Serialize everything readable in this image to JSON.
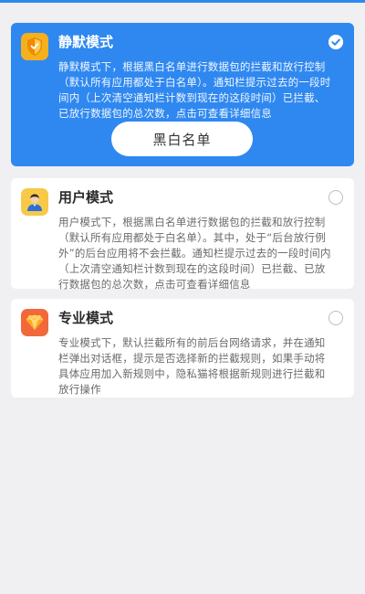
{
  "modes": {
    "silent": {
      "title": "静默模式",
      "icon": "shield-icon",
      "selected": true,
      "description": "静默模式下，根据黑白名单进行数据包的拦截和放行控制（默认所有应用都处于白名单）。通知栏提示过去的一段时间内（上次清空通知栏计数到现在的这段时间）已拦截、已放行数据包的总次数，点击可查看详细信息",
      "button_label": "黑白名单"
    },
    "user": {
      "title": "用户模式",
      "icon": "user-avatar-icon",
      "selected": false,
      "description": "用户模式下，根据黑白名单进行数据包的拦截和放行控制（默认所有应用都处于白名单）。其中，处于“后台放行例外”的后台应用将不会拦截。通知栏提示过去的一段时间内（上次清空通知栏计数到现在的这段时间）已拦截、已放行数据包的总次数，点击可查看详细信息"
    },
    "pro": {
      "title": "专业模式",
      "icon": "diamond-icon",
      "selected": false,
      "description": "专业模式下，默认拦截所有的前后台网络请求，并在通知栏弹出对话框，提示是否选择新的拦截规则，如果手动将具体应用加入新规则中，隐私猫将根据新规则进行拦截和放行操作"
    }
  },
  "colors": {
    "accent": "#2f88f0",
    "background": "#f0f0f2",
    "shield": "#f5b01e",
    "avatar": "#f7c948",
    "diamond": "#f2683a"
  }
}
